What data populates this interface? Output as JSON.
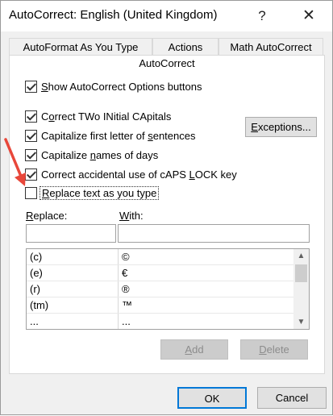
{
  "window": {
    "title": "AutoCorrect: English (United Kingdom)",
    "help_label": "?",
    "close_label": "✕"
  },
  "tabs": {
    "autoformat": "AutoFormat As You Type",
    "actions": "Actions",
    "math": "Math AutoCorrect",
    "autocorrect": "AutoCorrect"
  },
  "options": {
    "show_buttons": {
      "pre": "",
      "key": "S",
      "post": "how AutoCorrect Options buttons",
      "checked": true
    },
    "two_initial": {
      "pre": "C",
      "key": "o",
      "post": "rrect TWo INitial CApitals",
      "checked": true
    },
    "first_letter": {
      "pre": "Capitalize first letter of ",
      "key": "s",
      "post": "entences",
      "checked": true
    },
    "names_days": {
      "pre": "Capitalize ",
      "key": "n",
      "post": "ames of days",
      "checked": true
    },
    "caps_lock": {
      "pre": "Correct accidental use of cAPS ",
      "key": "L",
      "post": "OCK key",
      "checked": true
    },
    "replace_text": {
      "pre": "",
      "key": "R",
      "post": "eplace text as you type",
      "checked": false
    }
  },
  "buttons": {
    "exceptions": {
      "pre": "",
      "key": "E",
      "post": "xceptions..."
    },
    "add": {
      "pre": "",
      "key": "A",
      "post": "dd"
    },
    "delete": {
      "pre": "",
      "key": "D",
      "post": "elete"
    },
    "ok": "OK",
    "cancel": "Cancel"
  },
  "fields": {
    "replace_label": {
      "pre": "",
      "key": "R",
      "post": "eplace:"
    },
    "with_label": {
      "pre": "",
      "key": "W",
      "post": "ith:"
    },
    "replace_value": "",
    "with_value": ""
  },
  "list": {
    "rows": [
      {
        "replace": "(c)",
        "with": "©"
      },
      {
        "replace": "(e)",
        "with": "€"
      },
      {
        "replace": "(r)",
        "with": "®"
      },
      {
        "replace": "(tm)",
        "with": "™"
      },
      {
        "replace": "...",
        "with": "..."
      }
    ]
  },
  "colors": {
    "focus_border": "#0078d7",
    "annotation_arrow": "#e8473a"
  },
  "icons": {
    "help": "question-mark-icon",
    "close": "close-icon",
    "scroll_up": "chevron-up-icon",
    "scroll_down": "chevron-down-icon"
  }
}
